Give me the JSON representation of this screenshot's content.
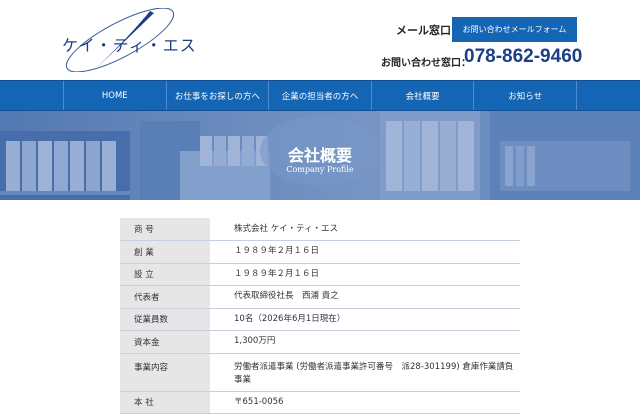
{
  "header": {
    "logo_text": "ケイ・ティ・エス",
    "mail_label": "メール窓口：",
    "mail_button_label": "お問い合わせメールフォーム",
    "phone_label": "お問い合わせ窓口：",
    "phone_number": "078-862-9460"
  },
  "nav": {
    "items": [
      {
        "label": "HOME"
      },
      {
        "label": "お仕事をお探しの方へ"
      },
      {
        "label": "企業の担当者の方へ"
      },
      {
        "label": "会社概要"
      },
      {
        "label": "お知らせ"
      }
    ]
  },
  "hero": {
    "title": "会社概要",
    "subtitle": "Company Profile"
  },
  "profile": {
    "rows": [
      {
        "label": "商 号",
        "value": "株式会社 ケイ・ティ・エス"
      },
      {
        "label": "創 業",
        "value": "１９８９年２月１６日"
      },
      {
        "label": "設 立",
        "value": "１９８９年２月１６日"
      },
      {
        "label": "代表者",
        "value": "代表取締役社長　西浦 貴之"
      },
      {
        "label": "従業員数",
        "value": "10名（2026年6月1日現在）"
      },
      {
        "label": "資本金",
        "value": "1,300万円"
      },
      {
        "label": "事業内容",
        "value": "労働者派遣事業 (労働者派遣事業許可番号　派28-301199) 倉庫作業請負事業"
      },
      {
        "label": "本 社",
        "value": "〒651-0056"
      }
    ]
  },
  "colors": {
    "brand_blue": "#1565b5",
    "logo_navy": "#1a3f86",
    "label_bg": "#e6e6e6"
  }
}
